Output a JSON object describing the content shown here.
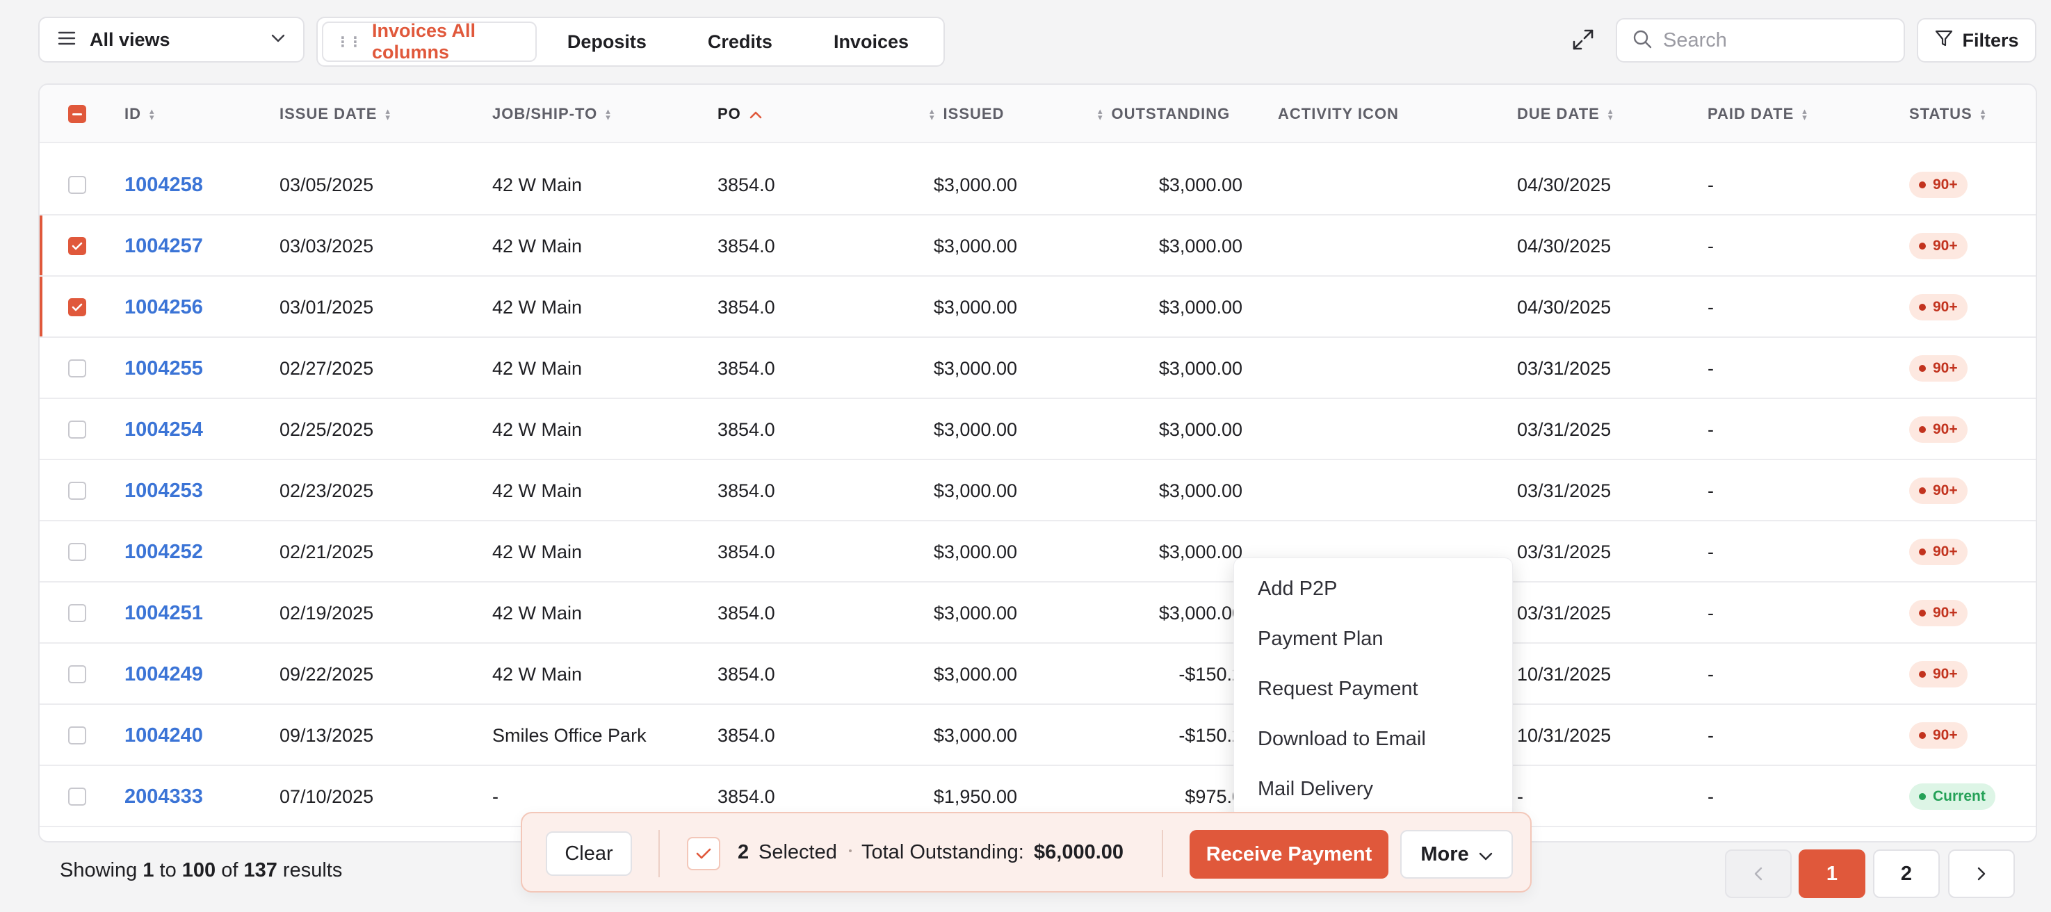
{
  "toolbar": {
    "views_label": "All views",
    "tabs": [
      {
        "label": "Invoices All columns",
        "active": true
      },
      {
        "label": "Deposits",
        "active": false
      },
      {
        "label": "Credits",
        "active": false
      },
      {
        "label": "Invoices",
        "active": false
      }
    ],
    "search_placeholder": "Search",
    "filters_label": "Filters"
  },
  "table": {
    "columns": [
      "ID",
      "ISSUE DATE",
      "JOB/SHIP-TO",
      "PO",
      "ISSUED",
      "OUTSTANDING",
      "ACTIVITY ICON",
      "DUE DATE",
      "PAID DATE",
      "STATUS"
    ],
    "rows": [
      {
        "id": "1004258",
        "issue_date": "03/05/2025",
        "job": "42 W Main",
        "po": "3854.0",
        "issued": "$3,000.00",
        "outstanding": "$3,000.00",
        "due_date": "04/30/2025",
        "paid_date": "-",
        "status": "90+",
        "selected": false
      },
      {
        "id": "1004257",
        "issue_date": "03/03/2025",
        "job": "42 W Main",
        "po": "3854.0",
        "issued": "$3,000.00",
        "outstanding": "$3,000.00",
        "due_date": "04/30/2025",
        "paid_date": "-",
        "status": "90+",
        "selected": true
      },
      {
        "id": "1004256",
        "issue_date": "03/01/2025",
        "job": "42 W Main",
        "po": "3854.0",
        "issued": "$3,000.00",
        "outstanding": "$3,000.00",
        "due_date": "04/30/2025",
        "paid_date": "-",
        "status": "90+",
        "selected": true
      },
      {
        "id": "1004255",
        "issue_date": "02/27/2025",
        "job": "42 W Main",
        "po": "3854.0",
        "issued": "$3,000.00",
        "outstanding": "$3,000.00",
        "due_date": "03/31/2025",
        "paid_date": "-",
        "status": "90+",
        "selected": false
      },
      {
        "id": "1004254",
        "issue_date": "02/25/2025",
        "job": "42 W Main",
        "po": "3854.0",
        "issued": "$3,000.00",
        "outstanding": "$3,000.00",
        "due_date": "03/31/2025",
        "paid_date": "-",
        "status": "90+",
        "selected": false
      },
      {
        "id": "1004253",
        "issue_date": "02/23/2025",
        "job": "42 W Main",
        "po": "3854.0",
        "issued": "$3,000.00",
        "outstanding": "$3,000.00",
        "due_date": "03/31/2025",
        "paid_date": "-",
        "status": "90+",
        "selected": false
      },
      {
        "id": "1004252",
        "issue_date": "02/21/2025",
        "job": "42 W Main",
        "po": "3854.0",
        "issued": "$3,000.00",
        "outstanding": "$3,000.00",
        "due_date": "03/31/2025",
        "paid_date": "-",
        "status": "90+",
        "selected": false
      },
      {
        "id": "1004251",
        "issue_date": "02/19/2025",
        "job": "42 W Main",
        "po": "3854.0",
        "issued": "$3,000.00",
        "outstanding": "$3,000.00",
        "due_date": "03/31/2025",
        "paid_date": "-",
        "status": "90+",
        "selected": false
      },
      {
        "id": "1004249",
        "issue_date": "09/22/2025",
        "job": "42 W Main",
        "po": "3854.0",
        "issued": "$3,000.00",
        "outstanding": "-$150.2",
        "due_date": "10/31/2025",
        "paid_date": "-",
        "status": "90+",
        "selected": false
      },
      {
        "id": "1004240",
        "issue_date": "09/13/2025",
        "job": "Smiles Office Park",
        "po": "3854.0",
        "issued": "$3,000.00",
        "outstanding": "-$150.2",
        "due_date": "10/31/2025",
        "paid_date": "-",
        "status": "90+",
        "selected": false
      },
      {
        "id": "2004333",
        "issue_date": "07/10/2025",
        "job": "-",
        "po": "3854.0",
        "issued": "$1,950.00",
        "outstanding": "$975.0",
        "due_date": "-",
        "paid_date": "-",
        "status": "Current",
        "selected": false
      }
    ]
  },
  "more_menu": {
    "items": [
      "Add P2P",
      "Payment Plan",
      "Request Payment",
      "Download to Email",
      "Mail Delivery"
    ]
  },
  "footer": {
    "showing_prefix": "Showing",
    "range_start": "1",
    "to_word": "to",
    "range_end": "100",
    "of_word": "of",
    "total": "137",
    "results_word": "results",
    "pages": [
      "1",
      "2"
    ]
  },
  "selection_bar": {
    "clear_label": "Clear",
    "count": "2",
    "selected_label": "Selected",
    "total_label": "Total Outstanding:",
    "total_value": "$6,000.00",
    "receive_label": "Receive Payment",
    "more_label": "More"
  },
  "colors": {
    "accent": "#e0583b",
    "link": "#3b74d6",
    "overdue_badge_bg": "#fde8e0",
    "overdue_badge_text": "#c2331e",
    "current_badge_bg": "#ddf5e6",
    "current_badge_text": "#24a157"
  }
}
